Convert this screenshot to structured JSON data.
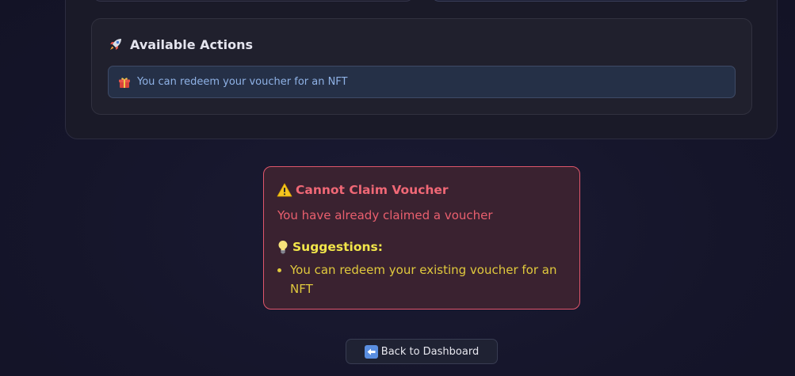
{
  "actions": {
    "title": "Available Actions",
    "title_icon": "rocket-icon",
    "items": [
      {
        "icon": "gift-icon",
        "label": "You can redeem your voucher for an NFT"
      }
    ]
  },
  "error": {
    "title": "Cannot Claim Voucher",
    "title_icon": "warning-icon",
    "message": "You have already claimed a voucher",
    "suggestions_title": "Suggestions:",
    "suggestions_icon": "lightbulb-icon",
    "suggestions": [
      "You can redeem your existing voucher for an NFT"
    ]
  },
  "back_button": {
    "icon": "back-arrow-icon",
    "label": "Back to Dashboard"
  },
  "colors": {
    "error_border": "#e0566b",
    "error_text": "#f06876",
    "suggestion_text": "#e0c93d",
    "action_text": "#8fb2e6"
  }
}
